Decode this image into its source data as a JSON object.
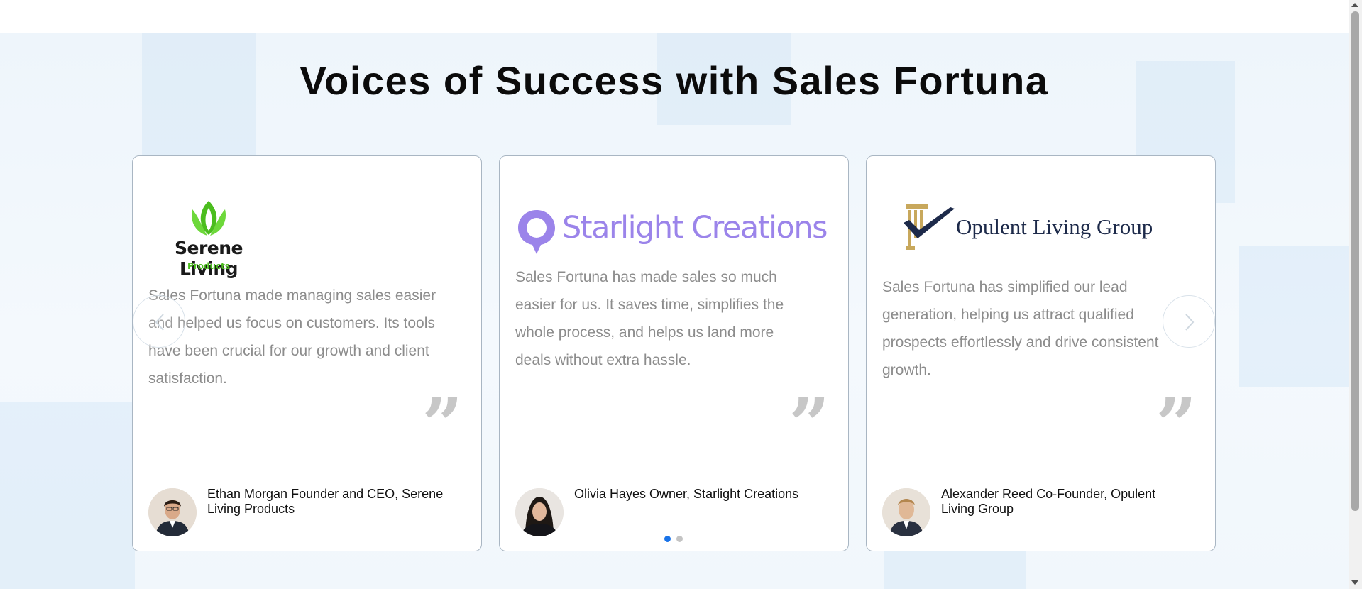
{
  "section": {
    "title": "Voices of Success with Sales Fortuna"
  },
  "testimonials": [
    {
      "logo": {
        "name": "Serene Living",
        "sub": "Products",
        "icon": "green-lotus-leaves",
        "color": "#4bbd1e"
      },
      "quote": "Sales Fortuna made managing sales easier and helped us focus on customers. Its tools have been crucial for our growth and client satisfaction.",
      "quote_mark": "”",
      "author": "Ethan Morgan Founder and CEO, Serene Living Products"
    },
    {
      "logo": {
        "name": "Starlight Creations",
        "icon": "purple-speech-bubble",
        "color": "#9b84ea"
      },
      "quote": "Sales Fortuna has made sales so much easier for us. It saves time, simplifies the whole process, and helps us land more deals without extra hassle.",
      "quote_mark": "”",
      "author": "Olivia Hayes Owner, Starlight Creations"
    },
    {
      "logo": {
        "name": "Opulent Living Group",
        "icon": "gold-column-checkmark",
        "color": "#1d2a4a"
      },
      "quote": "Sales Fortuna has simplified our lead generation, helping us attract qualified prospects effortlessly and drive consistent growth.",
      "quote_mark": "”",
      "author": "Alexander Reed Co-Founder, Opulent Living Group"
    }
  ],
  "carousel": {
    "prev_icon": "chevron-left-icon",
    "next_icon": "chevron-right-icon",
    "active_dot": 0,
    "dot_count": 2,
    "active_color": "#1a73e8",
    "inactive_color": "#c4c4c4"
  }
}
